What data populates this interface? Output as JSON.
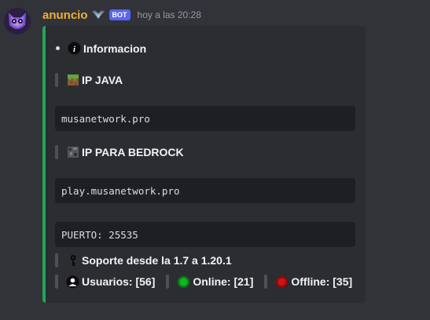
{
  "message": {
    "username": "anuncio",
    "bot_tag": "BOT",
    "timestamp": "hoy a las 20:28"
  },
  "embed": {
    "accent_color": "#23a55a",
    "info_label": "Informacion",
    "java_label": "IP JAVA",
    "java_ip": "musanetwork.pro",
    "bedrock_label": "IP PARA BEDROCK",
    "bedrock_ip": "play.musanetwork.pro",
    "port_text": "PUERTO: 25535",
    "support_text": "Soporte desde la 1.7 a 1.20.1",
    "users_text": "Usuarios: [56]",
    "online_text": "Online: [21]",
    "offline_text": "Offline: [35]"
  },
  "icons": {
    "info": "info-icon",
    "java": "grass-block-icon",
    "bedrock": "bedrock-block-icon",
    "support": "key-icon",
    "users": "user-icon",
    "online": "green-circle-icon",
    "offline": "red-circle-icon"
  }
}
